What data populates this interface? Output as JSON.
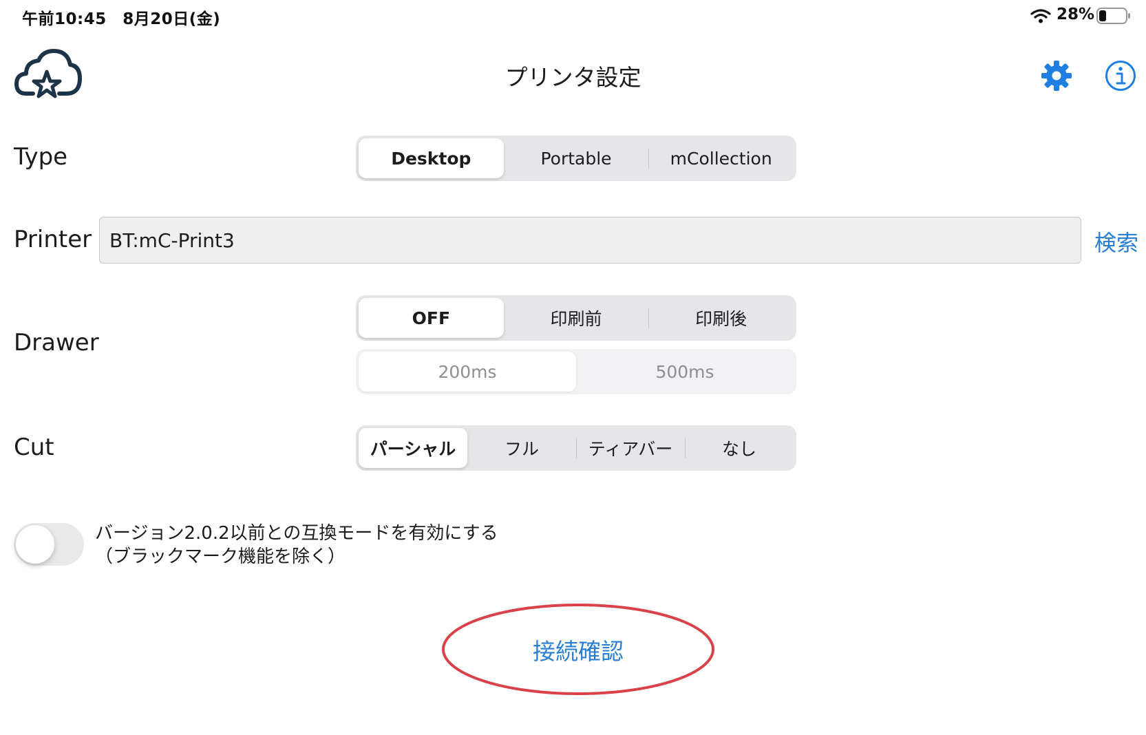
{
  "status_bar": {
    "time": "午前10:45　8月20日(金)",
    "battery": "28%",
    "battery_level": 0.28
  },
  "nav": {
    "title": "プリンタ設定",
    "icons": [
      "cloud-star-logo-icon",
      "gear-icon",
      "info-icon"
    ]
  },
  "type_row": {
    "label": "Type",
    "options": [
      "Desktop",
      "Portable",
      "mCollection"
    ],
    "selected": "Desktop"
  },
  "printer_row": {
    "label": "Printer",
    "value": "BT:mC-Print3",
    "search_label": "検索"
  },
  "drawer_row": {
    "label": "Drawer",
    "options": [
      "OFF",
      "印刷前",
      "印刷後"
    ],
    "selected": "OFF",
    "duration_options": [
      "200ms",
      "500ms"
    ],
    "duration_selected": "200ms",
    "duration_enabled": false
  },
  "cut_row": {
    "label": "Cut",
    "options": [
      "パーシャル",
      "フル",
      "ティアバー",
      "なし"
    ],
    "selected": "パーシャル"
  },
  "compat": {
    "line1": "バージョン2.0.2以前との互換モードを有効にする",
    "line2": "（ブラックマーク機能を除く）",
    "enabled": false
  },
  "connect_button": {
    "label": "接続確認"
  },
  "colors": {
    "accent": "#2a7ed3",
    "logo": "#1d3347",
    "annotation_circle": "#d9424a"
  }
}
